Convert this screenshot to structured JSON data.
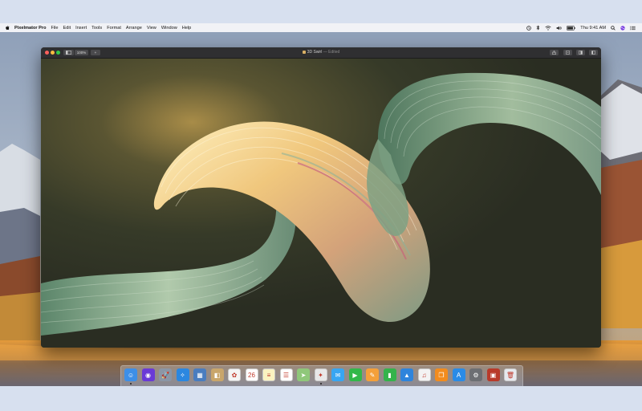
{
  "menubar": {
    "app_name": "Pixelmator Pro",
    "items": [
      "File",
      "Edit",
      "Insert",
      "Tools",
      "Format",
      "Arrange",
      "View",
      "Window",
      "Help"
    ],
    "clock": "Thu 9:41 AM",
    "status_icons": [
      "time-machine-icon",
      "bluetooth-icon",
      "wifi-icon",
      "volume-icon",
      "battery-icon",
      "spotlight-icon",
      "siri-icon",
      "notification-center-icon"
    ]
  },
  "window": {
    "zoom_label": "100%",
    "view_label": "",
    "add_label": "+",
    "document_title": "3D Swirl",
    "document_status": "— Edited",
    "toolbar_icons": [
      "share-icon",
      "tools-icon",
      "layers-icon",
      "adjust-icon"
    ]
  },
  "dock": {
    "apps": [
      {
        "name": "finder",
        "color": "#3d8fe8",
        "glyph": "☺"
      },
      {
        "name": "siri",
        "color": "#6a3ad6",
        "glyph": "◉"
      },
      {
        "name": "launchpad",
        "color": "#8b96a6",
        "glyph": "🚀"
      },
      {
        "name": "safari",
        "color": "#2b87e0",
        "glyph": "✧"
      },
      {
        "name": "photo-browser",
        "color": "#4a7dbf",
        "glyph": "▦"
      },
      {
        "name": "contacts",
        "color": "#c9a66b",
        "glyph": "◧"
      },
      {
        "name": "photos",
        "color": "#f4f4f4",
        "glyph": "✿"
      },
      {
        "name": "calendar",
        "color": "#ffffff",
        "glyph": "26"
      },
      {
        "name": "notes",
        "color": "#fbf3c0",
        "glyph": "≡"
      },
      {
        "name": "reminders",
        "color": "#ffffff",
        "glyph": "☰"
      },
      {
        "name": "maps",
        "color": "#8fc77a",
        "glyph": "➤"
      },
      {
        "name": "pixelmator",
        "color": "#e8e8e8",
        "glyph": "✦"
      },
      {
        "name": "messages",
        "color": "#37a6f2",
        "glyph": "✉"
      },
      {
        "name": "facetime",
        "color": "#32b84a",
        "glyph": "▶"
      },
      {
        "name": "pages",
        "color": "#f4a03a",
        "glyph": "✎"
      },
      {
        "name": "numbers",
        "color": "#34b34b",
        "glyph": "▮"
      },
      {
        "name": "keynote",
        "color": "#2e84dc",
        "glyph": "▲"
      },
      {
        "name": "itunes",
        "color": "#f3f3f3",
        "glyph": "♫"
      },
      {
        "name": "ibooks",
        "color": "#f28c1e",
        "glyph": "❐"
      },
      {
        "name": "app-store",
        "color": "#2a8be6",
        "glyph": "A"
      },
      {
        "name": "system-preferences",
        "color": "#6d6f73",
        "glyph": "⚙"
      },
      {
        "name": "photo-booth",
        "color": "#b83a2a",
        "glyph": "▣"
      },
      {
        "name": "trash",
        "color": "#e6e9ee",
        "glyph": "🗑"
      }
    ]
  },
  "colors": {
    "canvas_bg": "#3b3f2d",
    "ribbon_warm": "#f0d49a",
    "ribbon_green": "#7e9e83",
    "traffic_red": "#fc605c",
    "traffic_yellow": "#fdbc40",
    "traffic_green": "#34c84a"
  }
}
